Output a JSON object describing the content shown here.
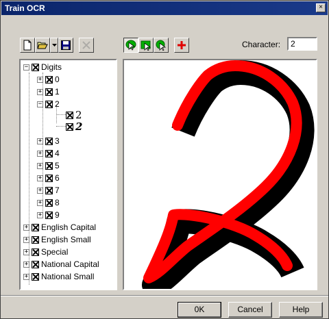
{
  "window": {
    "title": "Train OCR",
    "close_label": "×"
  },
  "toolbar": {
    "buttons": [
      {
        "name": "new-icon"
      },
      {
        "name": "open-folder-icon"
      },
      {
        "name": "dropdown-arrow-icon"
      },
      {
        "name": "save-icon"
      },
      {
        "name": "delete-icon"
      }
    ],
    "tools": [
      {
        "name": "pen-select-icon"
      },
      {
        "name": "rect-select-icon"
      },
      {
        "name": "zoom-select-icon"
      },
      {
        "name": "add-icon"
      }
    ]
  },
  "character": {
    "label": "Character:",
    "value": "2"
  },
  "tree": {
    "root": {
      "label": "Digits"
    },
    "digits": [
      "0",
      "1",
      "2",
      "3",
      "4",
      "5",
      "6",
      "7",
      "8",
      "9"
    ],
    "samples": [
      "2",
      "2"
    ],
    "categories": [
      "English Capital",
      "English Small",
      "Special",
      "National Capital",
      "National Small"
    ]
  },
  "buttons": {
    "ok": "0K",
    "cancel": "Cancel",
    "help": "Help"
  },
  "colors": {
    "stroke": "#ff0000",
    "shadow": "#000000",
    "titlebar": "#0a246a"
  }
}
